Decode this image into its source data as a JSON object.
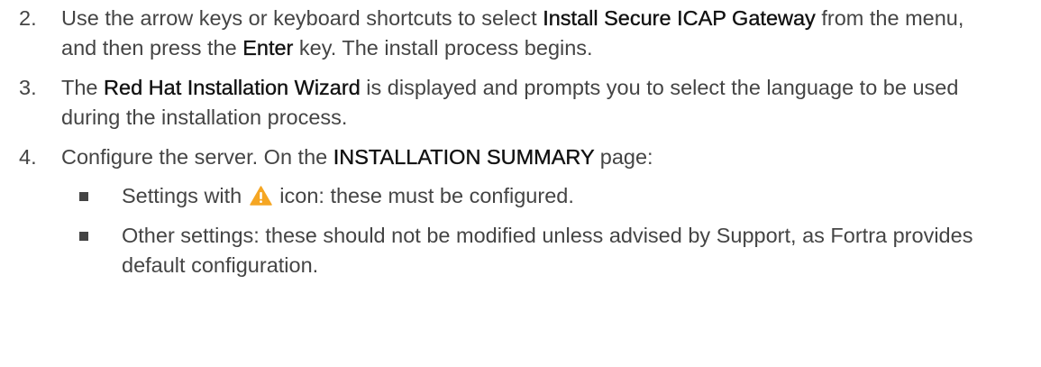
{
  "steps": [
    {
      "number": "2.",
      "parts": [
        {
          "text": "Use the arrow keys or keyboard shortcuts to select ",
          "bold": false
        },
        {
          "text": "Install Secure ICAP Gateway",
          "bold": true
        },
        {
          "text": " from the menu, and then press the ",
          "bold": false
        },
        {
          "text": "Enter",
          "bold": true
        },
        {
          "text": " key. The install process begins.",
          "bold": false
        }
      ]
    },
    {
      "number": "3.",
      "parts": [
        {
          "text": "The ",
          "bold": false
        },
        {
          "text": "Red Hat Installation Wizard",
          "bold": true
        },
        {
          "text": " is displayed and prompts you to select the language to be used during the installation process.",
          "bold": false
        }
      ]
    },
    {
      "number": "4.",
      "parts": [
        {
          "text": "Configure the server. On the ",
          "bold": false
        },
        {
          "text": "INSTALLATION SUMMARY",
          "bold": true
        },
        {
          "text": " page:",
          "bold": false
        }
      ]
    }
  ],
  "bullets": [
    {
      "before_icon": "Settings with ",
      "icon": "warning-icon",
      "after_icon": " icon: these must be configured."
    },
    {
      "text": "Other settings: these should not be modified unless advised by Support, as Fortra provides default configuration."
    }
  ],
  "colors": {
    "text": "#444444",
    "bold_text": "#111111",
    "warning_fill": "#f5a623"
  }
}
